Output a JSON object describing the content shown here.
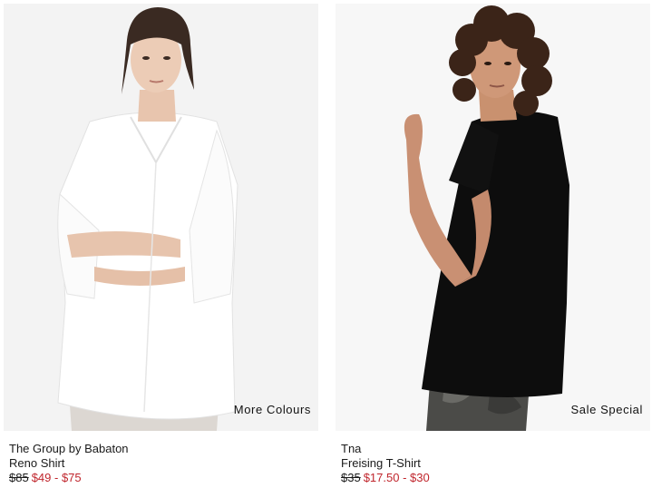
{
  "colors": {
    "sale_price": "#c0262d",
    "text": "#1a1a1a"
  },
  "products": [
    {
      "brand": "The Group by Babaton",
      "name": "Reno Shirt",
      "price_original": "$85",
      "price_sale": "$49 - $75",
      "badge": "More Colours",
      "image": "woman-white-shirt-photo"
    },
    {
      "brand": "Tna",
      "name": "Freising T-Shirt",
      "price_original": "$35",
      "price_sale": "$17.50 - $30",
      "badge": "Sale Special",
      "image": "woman-black-tshirt-photo"
    }
  ]
}
